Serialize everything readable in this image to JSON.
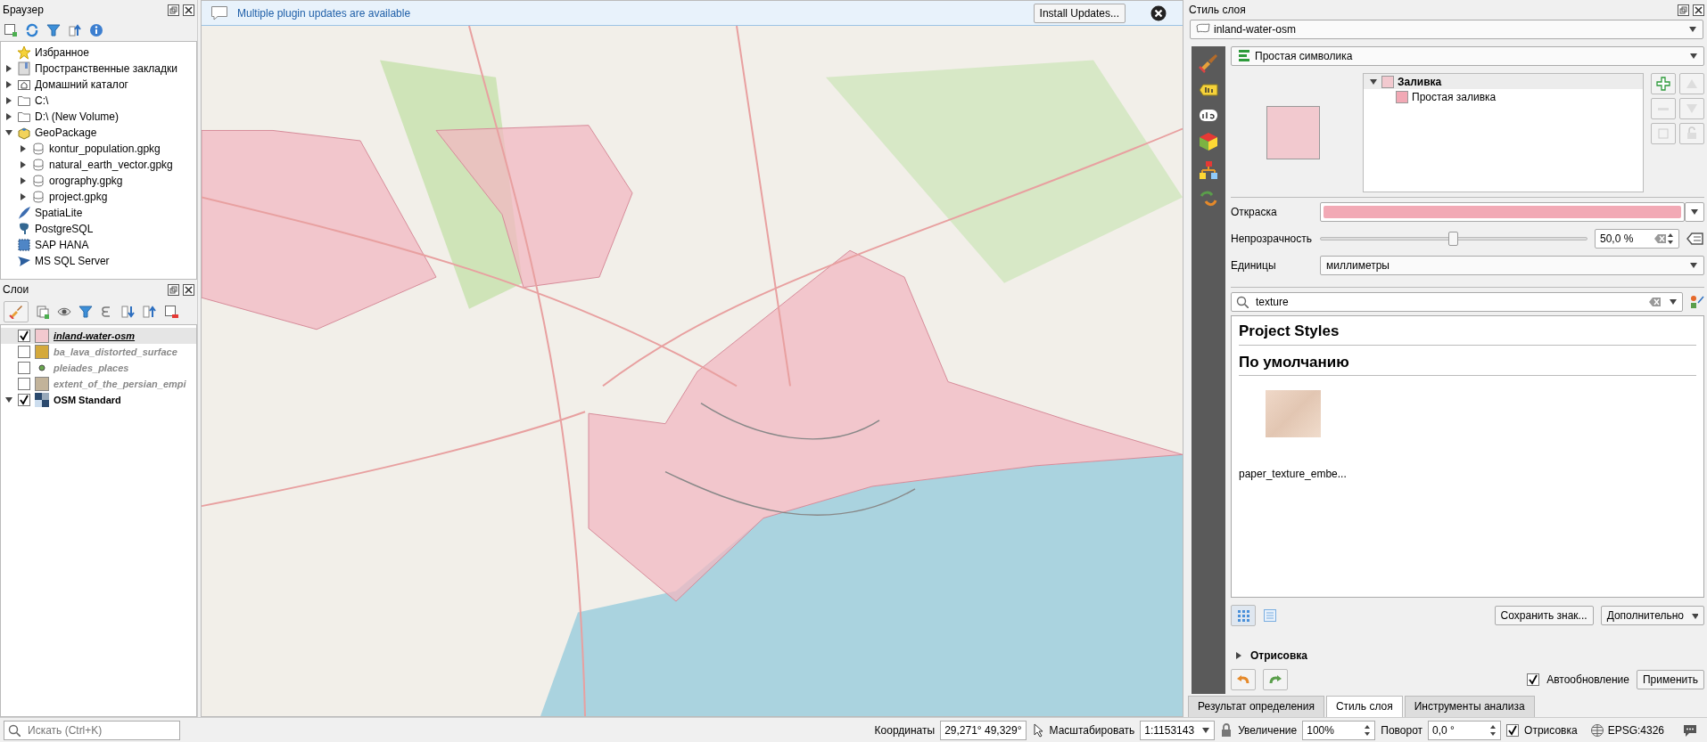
{
  "browser_panel": {
    "title": "Браузер",
    "items": [
      {
        "label": "Избранное",
        "kind": "favorites"
      },
      {
        "label": "Пространственные закладки",
        "kind": "bookmarks",
        "expanded": false
      },
      {
        "label": "Домашний каталог",
        "kind": "home",
        "expanded": false
      },
      {
        "label": "C:\\",
        "kind": "folder",
        "expanded": false
      },
      {
        "label": "D:\\ (New Volume)",
        "kind": "folder",
        "expanded": false
      },
      {
        "label": "GeoPackage",
        "kind": "geopackage",
        "expanded": true,
        "children": [
          {
            "label": "kontur_population.gpkg",
            "kind": "database",
            "expanded": false
          },
          {
            "label": "natural_earth_vector.gpkg",
            "kind": "database",
            "expanded": false
          },
          {
            "label": "orography.gpkg",
            "kind": "database",
            "expanded": false
          },
          {
            "label": "project.gpkg",
            "kind": "database",
            "expanded": false
          }
        ]
      },
      {
        "label": "SpatiaLite",
        "kind": "spatialite"
      },
      {
        "label": "PostgreSQL",
        "kind": "postgres"
      },
      {
        "label": "SAP HANA",
        "kind": "saphana"
      },
      {
        "label": "MS SQL Server",
        "kind": "mssql"
      }
    ]
  },
  "layers_panel": {
    "title": "Слои",
    "layers": [
      {
        "name": "inland-water-osm",
        "kind": "polygon",
        "checked": true,
        "selected": true,
        "color": "#f2c9cf"
      },
      {
        "name": "ba_lava_distorted_surface",
        "kind": "polygon",
        "checked": false,
        "selected": false,
        "color": "#d4a93c"
      },
      {
        "name": "pleiades_places",
        "kind": "point",
        "checked": false,
        "selected": false,
        "color": "#6aa84f"
      },
      {
        "name": "extent_of_the_persian_empi",
        "kind": "polygon",
        "checked": false,
        "selected": false,
        "color": "#c2b39a"
      },
      {
        "name": "OSM Standard",
        "kind": "raster",
        "checked": true,
        "selected": false,
        "expanded": true
      }
    ]
  },
  "notification": {
    "message": "Multiple plugin updates are available",
    "button": "Install Updates..."
  },
  "style_panel": {
    "title": "Стиль слоя",
    "layer": "inland-water-osm",
    "renderer": "Простая символика",
    "symbol_tree": [
      {
        "label": "Заливка",
        "expanded": true,
        "children": [
          {
            "label": "Простая заливка"
          }
        ]
      }
    ],
    "fill_label": "Откраска",
    "opacity": {
      "label": "Непрозрачность",
      "level": 0.5,
      "reading": "50,0 %"
    },
    "units": {
      "label": "Единицы",
      "value": "миллиметры"
    },
    "search": {
      "value": "texture"
    },
    "library": [
      {
        "title": "Project Styles"
      },
      {
        "title": "По умолчанию",
        "items": [
          {
            "label": "paper_texture_embe..."
          }
        ]
      }
    ],
    "save_button": "Сохранить знак...",
    "more_button": "Дополнительно",
    "rendering_section": {
      "label": "Отрисовка",
      "expanded": false
    },
    "auto_update": {
      "label": "Автообновление",
      "checked": true
    },
    "apply_button": "Применить"
  },
  "bottom_tabs": [
    {
      "label": "Результат определения",
      "selected": false
    },
    {
      "label": "Стиль слоя",
      "selected": true
    },
    {
      "label": "Инструменты анализа",
      "selected": false
    }
  ],
  "status_bar": {
    "search_placeholder": "Искать (Ctrl+K)",
    "coordinates_label": "Координаты",
    "coordinates": "29,271° 49,329°",
    "scale_label": "Масштабировать",
    "scale": "1:1153143",
    "magnifier_label": "Увеличение",
    "magnifier": "100%",
    "rotation_label": "Поворот",
    "rotation": "0,0 °",
    "render": {
      "label": "Отрисовка",
      "checked": true
    },
    "crs": "EPSG:4326"
  }
}
